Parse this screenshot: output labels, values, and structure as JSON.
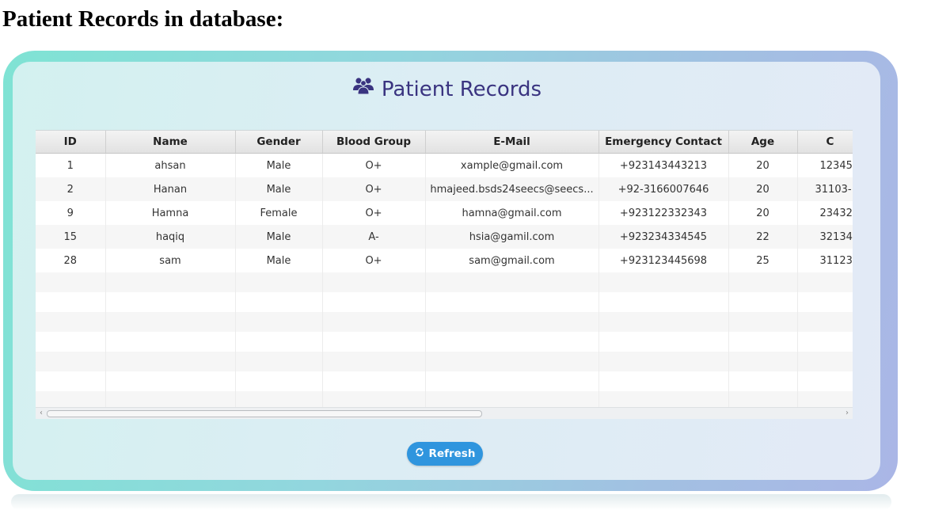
{
  "document": {
    "heading": "Patient Records in database:"
  },
  "app": {
    "title": "Patient Records",
    "title_icon": "users-icon",
    "accent_color": "#3a3480",
    "button_color": "#2f95de"
  },
  "table": {
    "columns": [
      "ID",
      "Name",
      "Gender",
      "Blood Group",
      "E-Mail",
      "Emergency Contact",
      "Age",
      "C"
    ],
    "rows": [
      [
        "1",
        "ahsan",
        "Male",
        "O+",
        "xample@gmail.com",
        "+923143443213",
        "20",
        "12345"
      ],
      [
        "2",
        "Hanan",
        "Male",
        "O+",
        "hmajeed.bsds24seecs@seecs...",
        "+92-3166007646",
        "20",
        "31103-"
      ],
      [
        "9",
        "Hamna",
        "Female",
        "O+",
        "hamna@gmail.com",
        "+923122332343",
        "20",
        "23432"
      ],
      [
        "15",
        "haqiq",
        "Male",
        "A-",
        "hsia@gamil.com",
        "+923234334545",
        "22",
        "32134"
      ],
      [
        "28",
        "sam",
        "Male",
        "O+",
        "sam@gmail.com",
        "+923123445698",
        "25",
        "31123"
      ]
    ]
  },
  "scrollbar": {
    "left_arrow": "‹",
    "right_arrow": "›"
  },
  "actions": {
    "refresh_label": "Refresh",
    "refresh_icon": "refresh-icon"
  }
}
